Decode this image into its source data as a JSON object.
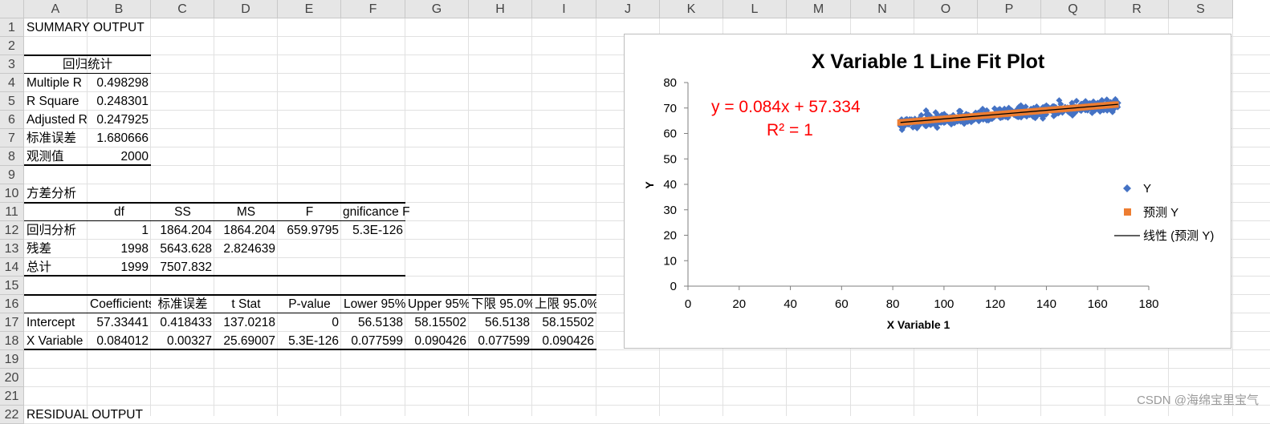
{
  "columns": [
    "A",
    "B",
    "C",
    "D",
    "E",
    "F",
    "G",
    "H",
    "I",
    "J",
    "K",
    "L",
    "M",
    "N",
    "O",
    "P",
    "Q",
    "R",
    "S"
  ],
  "rows": [
    "1",
    "2",
    "3",
    "4",
    "5",
    "6",
    "7",
    "8",
    "9",
    "10",
    "11",
    "12",
    "13",
    "14",
    "15",
    "16",
    "17",
    "18",
    "19",
    "20",
    "21",
    "22"
  ],
  "sheet": {
    "r1": {
      "a": "SUMMARY OUTPUT"
    },
    "r3": {
      "a": "回归统计"
    },
    "r4": {
      "a": "Multiple R",
      "b": "0.498298"
    },
    "r5": {
      "a": "R Square",
      "b": "0.248301"
    },
    "r6": {
      "a": "Adjusted R",
      "b": "0.247925"
    },
    "r7": {
      "a": "标准误差",
      "b": "1.680666"
    },
    "r8": {
      "a": "观测值",
      "b": "2000"
    },
    "r10": {
      "a": "方差分析"
    },
    "r11": {
      "b": "df",
      "c": "SS",
      "d": "MS",
      "e": "F",
      "f": "gnificance F"
    },
    "r12": {
      "a": "回归分析",
      "b": "1",
      "c": "1864.204",
      "d": "1864.204",
      "e": "659.9795",
      "f": "5.3E-126"
    },
    "r13": {
      "a": "残差",
      "b": "1998",
      "c": "5643.628",
      "d": "2.824639"
    },
    "r14": {
      "a": "总计",
      "b": "1999",
      "c": "7507.832"
    },
    "r16": {
      "b": "Coefficients",
      "c": "标准误差",
      "d": "t Stat",
      "e": "P-value",
      "f": "Lower 95%",
      "g": "Upper 95%",
      "h": "下限 95.0%",
      "i": "上限 95.0%"
    },
    "r17": {
      "a": "Intercept",
      "b": "57.33441",
      "c": "0.418433",
      "d": "137.0218",
      "e": "0",
      "f": "56.5138",
      "g": "58.15502",
      "h": "56.5138",
      "i": "58.15502"
    },
    "r18": {
      "a": "X Variable",
      "b": "0.084012",
      "c": "0.00327",
      "d": "25.69007",
      "e": "5.3E-126",
      "f": "0.077599",
      "g": "0.090426",
      "h": "0.077599",
      "i": "0.090426"
    },
    "r22": {
      "a": "RESIDUAL OUTPUT"
    }
  },
  "chart_data": {
    "type": "scatter",
    "title": "X Variable 1 Line Fit  Plot",
    "xlabel": "X Variable 1",
    "ylabel": "Y",
    "xlim": [
      0,
      180
    ],
    "ylim": [
      0,
      80
    ],
    "xticks": [
      "0",
      "20",
      "40",
      "60",
      "80",
      "100",
      "120",
      "140",
      "160",
      "180"
    ],
    "yticks": [
      "0",
      "10",
      "20",
      "30",
      "40",
      "50",
      "60",
      "70",
      "80"
    ],
    "trendline_equation": "y = 0.084x + 57.334",
    "trendline_r2": "R² = 1",
    "series": [
      {
        "name": "Y",
        "color": "#4472c4",
        "marker": "diamond",
        "x_range": [
          83,
          168
        ],
        "approx_points": [
          [
            83,
            63
          ],
          [
            86,
            65
          ],
          [
            93,
            69
          ],
          [
            95,
            64
          ],
          [
            100,
            66
          ],
          [
            105,
            65
          ],
          [
            110,
            67
          ],
          [
            115,
            66
          ],
          [
            120,
            68
          ],
          [
            125,
            69
          ],
          [
            130,
            70
          ],
          [
            135,
            70
          ],
          [
            140,
            71
          ],
          [
            145,
            73
          ],
          [
            150,
            72
          ],
          [
            155,
            71
          ],
          [
            160,
            72
          ],
          [
            165,
            70
          ],
          [
            168,
            72
          ]
        ]
      },
      {
        "name": "预测 Y",
        "color": "#ed7d31",
        "marker": "square",
        "x_range": [
          83,
          168
        ],
        "approx_points": [
          [
            83,
            64.3
          ],
          [
            168,
            71.4
          ]
        ]
      }
    ],
    "legend": [
      "Y",
      "预测 Y",
      "线性 (预测 Y)"
    ],
    "legend_position": "right",
    "grid": false
  },
  "watermark": "CSDN @海绵宝里宝气"
}
